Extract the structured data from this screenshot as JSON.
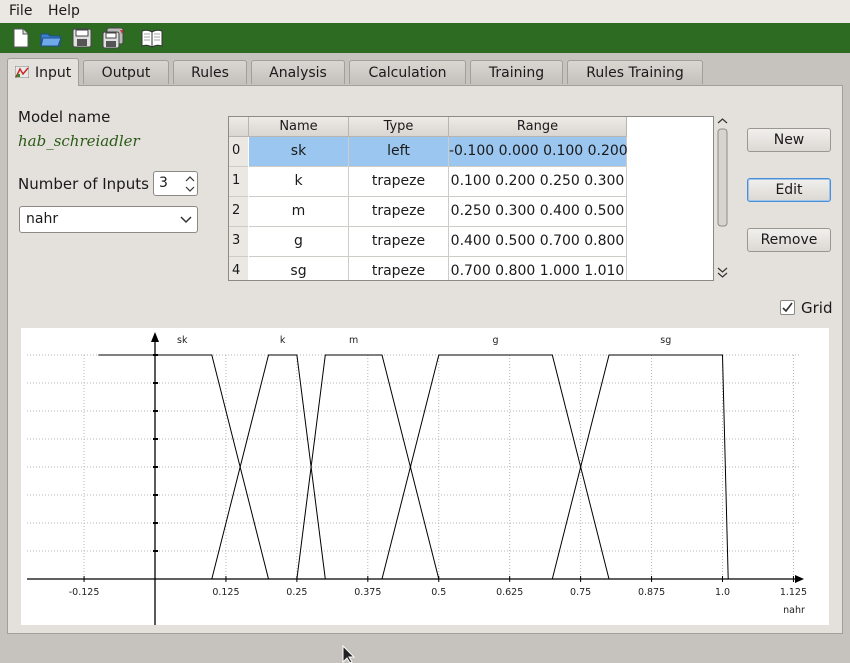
{
  "menubar": {
    "items": [
      "File",
      "Help"
    ]
  },
  "toolbar": {
    "buttons": [
      "new-file-icon",
      "open-folder-icon",
      "save-icon",
      "save-all-icon",
      "book-icon"
    ]
  },
  "tabs": [
    {
      "label": "Input",
      "active": true
    },
    {
      "label": "Output"
    },
    {
      "label": "Rules"
    },
    {
      "label": "Analysis"
    },
    {
      "label": "Calculation"
    },
    {
      "label": "Training"
    },
    {
      "label": "Rules Training"
    }
  ],
  "model": {
    "label": "Model name",
    "value": "hab_schreiadler"
  },
  "inputs": {
    "label": "Number of Inputs",
    "value": "3",
    "selected": "nahr"
  },
  "table": {
    "headers": [
      "Name",
      "Type",
      "Range"
    ],
    "rows": [
      {
        "index": "0",
        "name": "sk",
        "type": "left",
        "range": "-0.100 0.000 0.100 0.200"
      },
      {
        "index": "1",
        "name": "k",
        "type": "trapeze",
        "range": "0.100 0.200 0.250 0.300"
      },
      {
        "index": "2",
        "name": "m",
        "type": "trapeze",
        "range": "0.250 0.300 0.400 0.500"
      },
      {
        "index": "3",
        "name": "g",
        "type": "trapeze",
        "range": "0.400 0.500 0.700 0.800"
      },
      {
        "index": "4",
        "name": "sg",
        "type": "trapeze",
        "range": "0.700 0.800 1.000 1.010"
      }
    ],
    "selected_row": 0
  },
  "buttons": {
    "new": "New",
    "edit": "Edit",
    "remove": "Remove"
  },
  "grid": {
    "label": "Grid",
    "checked": true
  },
  "colors": {
    "toolbar": "#2d6a22",
    "selection": "#9bc6ef",
    "model_name": "#2b5a17"
  },
  "chart_data": {
    "type": "line",
    "xlabel": "nahr",
    "xlim": [
      -0.23,
      1.135
    ],
    "ylim": [
      0,
      1
    ],
    "x_ticks": [
      -0.125,
      0.125,
      0.25,
      0.375,
      0.5,
      0.625,
      0.75,
      0.875,
      1.0,
      1.125
    ],
    "x_tick_labels": [
      "-0.125",
      "0.125",
      "0.25",
      "0.375",
      "0.5",
      "0.625",
      "0.75",
      "0.875",
      "1.0",
      "1.125"
    ],
    "grid": true,
    "series": [
      {
        "name": "sk",
        "points": [
          [
            -0.1,
            1
          ],
          [
            0.0,
            1
          ],
          [
            0.1,
            1
          ],
          [
            0.2,
            0
          ]
        ]
      },
      {
        "name": "k",
        "points": [
          [
            0.1,
            0
          ],
          [
            0.2,
            1
          ],
          [
            0.25,
            1
          ],
          [
            0.3,
            0
          ]
        ]
      },
      {
        "name": "m",
        "points": [
          [
            0.25,
            0
          ],
          [
            0.3,
            1
          ],
          [
            0.4,
            1
          ],
          [
            0.5,
            0
          ]
        ]
      },
      {
        "name": "g",
        "points": [
          [
            0.4,
            0
          ],
          [
            0.5,
            1
          ],
          [
            0.7,
            1
          ],
          [
            0.8,
            0
          ]
        ]
      },
      {
        "name": "sg",
        "points": [
          [
            0.7,
            0
          ],
          [
            0.8,
            1
          ],
          [
            1.0,
            1
          ],
          [
            1.01,
            0
          ]
        ]
      }
    ]
  }
}
